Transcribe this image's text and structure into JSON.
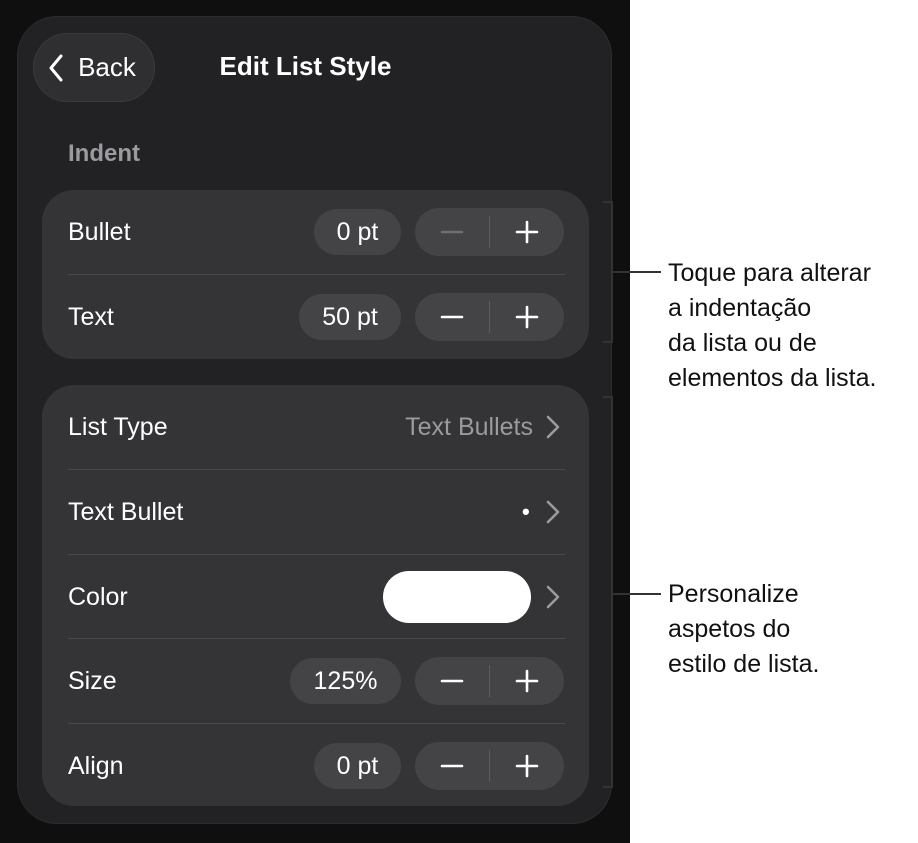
{
  "header": {
    "back_label": "Back",
    "title": "Edit List Style"
  },
  "indent": {
    "section_label": "Indent",
    "rows": [
      {
        "label": "Bullet",
        "value": "0 pt",
        "minus_enabled": false
      },
      {
        "label": "Text",
        "value": "50 pt",
        "minus_enabled": true
      }
    ]
  },
  "style": {
    "list_type": {
      "label": "List Type",
      "value": "Text Bullets"
    },
    "text_bullet": {
      "label": "Text Bullet",
      "value": "•"
    },
    "color": {
      "label": "Color",
      "swatch": "#ffffff"
    },
    "size": {
      "label": "Size",
      "value": "125%"
    },
    "align": {
      "label": "Align",
      "value": "0 pt"
    }
  },
  "steppers": {
    "minus": "−",
    "plus": "+"
  },
  "callouts": {
    "indent": [
      "Toque para alterar",
      "a indentação",
      "da lista ou de",
      "elementos da lista."
    ],
    "style": [
      "Personalize",
      "aspetos do",
      "estilo de lista."
    ]
  },
  "colors": {
    "panel": "#222224",
    "group": "#343437",
    "control": "#444447",
    "text": "#ffffff",
    "muted_text": "#9a9a9f"
  }
}
